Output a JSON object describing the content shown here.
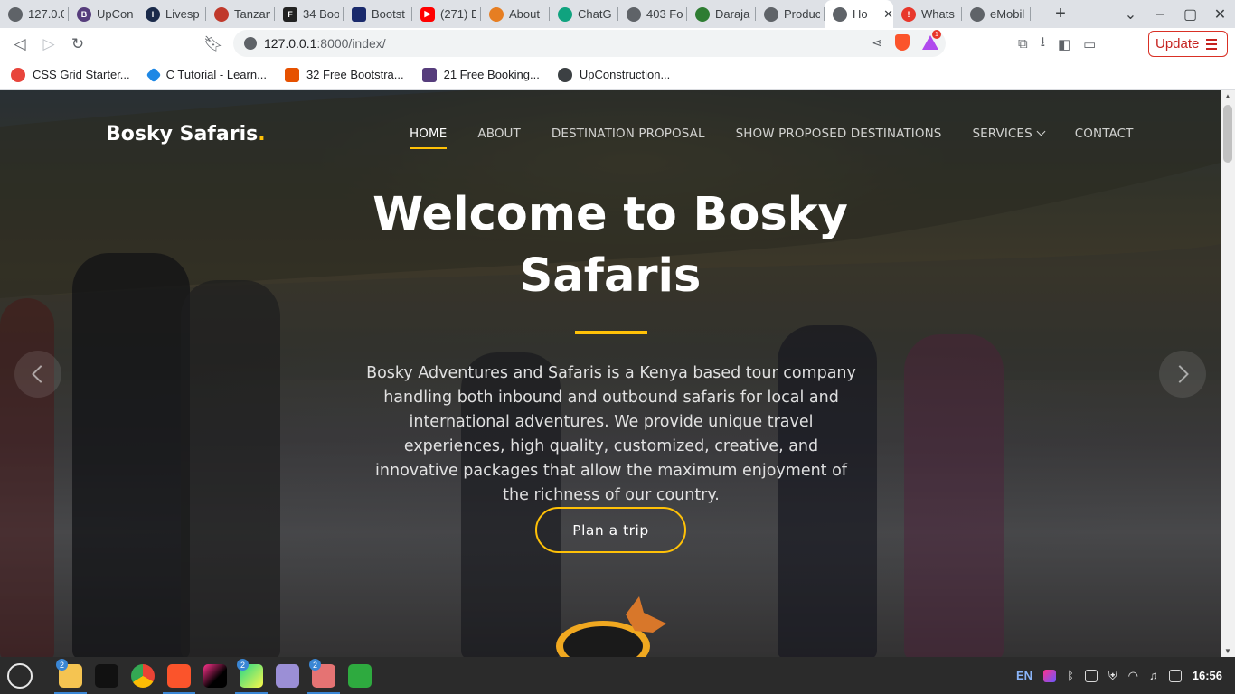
{
  "browser": {
    "tabs": [
      {
        "title": "127.0.0",
        "color": "#5f6368"
      },
      {
        "title": "UpCon",
        "color": "#563d7c"
      },
      {
        "title": "Livesp",
        "color": "#1a2a4a"
      },
      {
        "title": "Tanzan",
        "color": "#c0392b"
      },
      {
        "title": "34 Boo",
        "color": "#222222"
      },
      {
        "title": "Bootst",
        "color": "#1a2a6c"
      },
      {
        "title": "(271) B",
        "color": "#ff0000"
      },
      {
        "title": "About",
        "color": "#e67e22"
      },
      {
        "title": "ChatG",
        "color": "#10a37f"
      },
      {
        "title": "403 Fo",
        "color": "#5f6368"
      },
      {
        "title": "Daraja",
        "color": "#2e7d32"
      },
      {
        "title": "Produc",
        "color": "#5f6368"
      },
      {
        "title": "Ho",
        "color": "#5f6368",
        "active": true
      },
      {
        "title": "Whats",
        "color": "#e8372b"
      },
      {
        "title": "eMobil",
        "color": "#5f6368"
      }
    ],
    "new_tab": "+",
    "url_host": "127.0.0.1",
    "url_rest": ":8000/index/",
    "update_label": "Update",
    "brave_badge": "1",
    "bookmarks": [
      {
        "label": "CSS Grid Starter...",
        "color": "#e8453c"
      },
      {
        "label": "C Tutorial - Learn...",
        "color": "#1e88e5"
      },
      {
        "label": "32 Free Bootstra...",
        "color": "#e65100"
      },
      {
        "label": "21 Free Booking...",
        "color": "#563d7c"
      },
      {
        "label": "UpConstruction...",
        "color": "#3c4043"
      }
    ]
  },
  "site": {
    "brand": "Bosky Safaris",
    "brand_dot": ".",
    "nav": [
      {
        "label": "HOME"
      },
      {
        "label": "ABOUT"
      },
      {
        "label": "DESTINATION PROPOSAL"
      },
      {
        "label": "SHOW PROPOSED DESTINATIONS"
      },
      {
        "label": "SERVICES"
      },
      {
        "label": "CONTACT"
      }
    ],
    "hero_title_line1": "Welcome to Bosky",
    "hero_title_line2": "Safaris",
    "hero_text": "Bosky Adventures and Safaris is a Kenya based tour company handling both inbound and outbound safaris for local and international adventures. We provide unique travel experiences, high quality, customized, creative, and innovative packages that allow the maximum enjoyment of the richness of our country.",
    "cta_label": "Plan a trip",
    "accent": "#ffc107"
  },
  "taskbar": {
    "badges": [
      "2",
      "2",
      "2"
    ],
    "lang": "EN",
    "time": "16:56"
  }
}
